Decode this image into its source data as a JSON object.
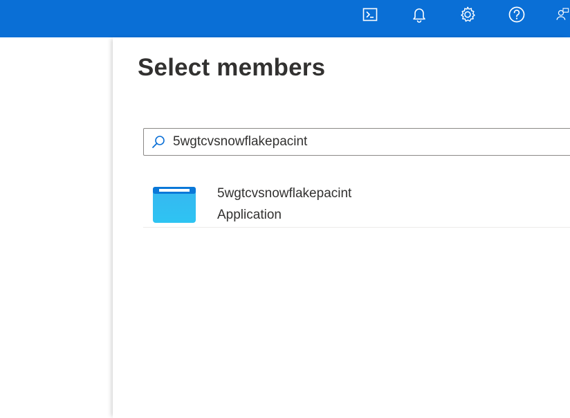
{
  "topbar": {
    "background_color": "#0a6fd6",
    "icons": [
      "cloud-shell-icon",
      "bell-icon",
      "gear-icon",
      "help-icon",
      "feedback-person-icon"
    ]
  },
  "blade": {
    "title": "Select members"
  },
  "search": {
    "value": "5wgtcvsnowflakepacint",
    "icon": "search-icon"
  },
  "results": [
    {
      "name": "5wgtcvsnowflakepacint",
      "type": "Application",
      "icon": "application-icon"
    }
  ]
}
